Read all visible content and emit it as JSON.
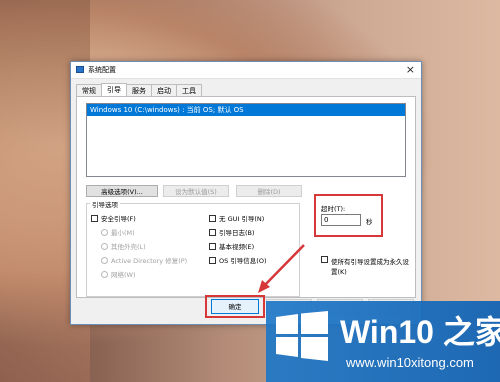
{
  "window": {
    "title": "系统配置",
    "close_glyph": "×"
  },
  "tabs": [
    {
      "label": "常规"
    },
    {
      "label": "引导"
    },
    {
      "label": "服务"
    },
    {
      "label": "启动"
    },
    {
      "label": "工具"
    }
  ],
  "active_tab": "引导",
  "os_list": {
    "entries": [
      "Windows 10 (C:\\windows) : 当前 OS; 默认 OS"
    ]
  },
  "buttons": {
    "advanced": "高级选项(V)...",
    "set_default": "设为默认值(S)",
    "delete": "删除(D)",
    "ok": "确定"
  },
  "boot_options": {
    "group_label": "引导选项",
    "safe_boot": "安全引导(F)",
    "minimal": "最小(M)",
    "alternate_shell": "其他外壳(L)",
    "active_directory_repair": "Active Directory 修复(P)",
    "network": "网络(W)",
    "no_gui_boot": "无 GUI 引导(N)",
    "boot_log": "引导日志(B)",
    "base_video": "基本视频(E)",
    "os_boot_info": "OS 引导信息(O)"
  },
  "timeout": {
    "label": "超时(T):",
    "value": "0",
    "unit": "秒"
  },
  "persistent": {
    "label": "使所有引导设置成为永久设置(K)"
  },
  "watermark": {
    "brand_main": "Win10",
    "brand_suffix": " 之家",
    "site": "www.win10xitong.com"
  },
  "colors": {
    "selection": "#0078d7",
    "highlight_box": "#d6383a",
    "logo_blue": "#1e78c8"
  }
}
